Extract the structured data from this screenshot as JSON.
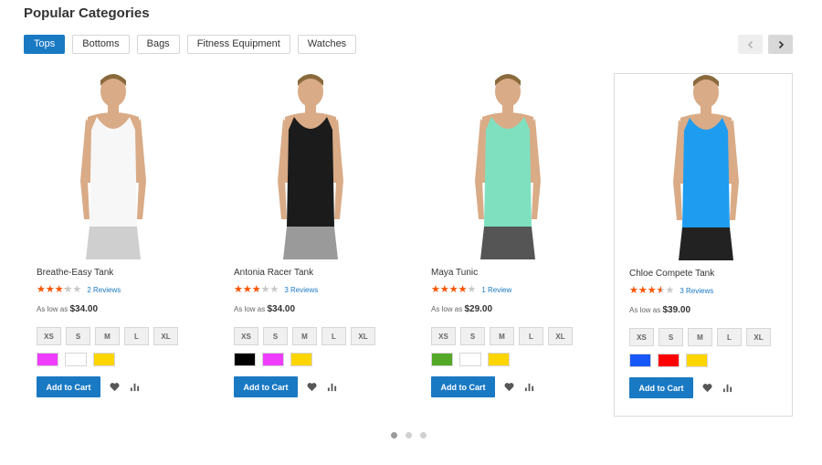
{
  "section": {
    "title": "Popular Categories"
  },
  "tabs": [
    {
      "label": "Tops",
      "active": true
    },
    {
      "label": "Bottoms",
      "active": false
    },
    {
      "label": "Bags",
      "active": false
    },
    {
      "label": "Fitness Equipment",
      "active": false
    },
    {
      "label": "Watches",
      "active": false
    }
  ],
  "carousel": {
    "prev_icon": "chevron-left-icon",
    "next_icon": "chevron-right-icon",
    "pages": 3,
    "active_page": 1
  },
  "products": [
    {
      "name": "Breathe-Easy Tank",
      "rating": 0.65,
      "reviews": "2  Reviews",
      "price_prefix": "As low as",
      "price": "$34.00",
      "sizes": [
        "XS",
        "S",
        "M",
        "L",
        "XL"
      ],
      "colors": [
        "#ef3dff",
        "#ffffff",
        "#ffd500"
      ],
      "add_to_cart": "Add to Cart",
      "top_color": "#f7f7f7",
      "bottom_color": "#cfcfcf",
      "highlighted": false
    },
    {
      "name": "Antonia Racer Tank",
      "rating": 0.6,
      "reviews": "3  Reviews",
      "price_prefix": "As low as",
      "price": "$34.00",
      "sizes": [
        "XS",
        "S",
        "M",
        "L",
        "XL"
      ],
      "colors": [
        "#000000",
        "#ef3dff",
        "#ffd500"
      ],
      "add_to_cart": "Add to Cart",
      "top_color": "#1b1b1b",
      "bottom_color": "#9a9a9a",
      "highlighted": false
    },
    {
      "name": "Maya Tunic",
      "rating": 0.8,
      "reviews": "1  Review",
      "price_prefix": "As low as",
      "price": "$29.00",
      "sizes": [
        "XS",
        "S",
        "M",
        "L",
        "XL"
      ],
      "colors": [
        "#53a828",
        "#ffffff",
        "#ffd500"
      ],
      "add_to_cart": "Add to Cart",
      "top_color": "#7fe0c0",
      "bottom_color": "#555555",
      "highlighted": false
    },
    {
      "name": "Chloe Compete Tank",
      "rating": 0.7,
      "reviews": "3  Reviews",
      "price_prefix": "As low as",
      "price": "$39.00",
      "sizes": [
        "XS",
        "S",
        "M",
        "L",
        "XL"
      ],
      "colors": [
        "#1857f7",
        "#ff0000",
        "#ffd500"
      ],
      "add_to_cart": "Add to Cart",
      "top_color": "#1e9cf0",
      "bottom_color": "#222222",
      "highlighted": true
    }
  ],
  "icons": {
    "wishlist": "heart-icon",
    "compare": "compare-bars-icon"
  }
}
